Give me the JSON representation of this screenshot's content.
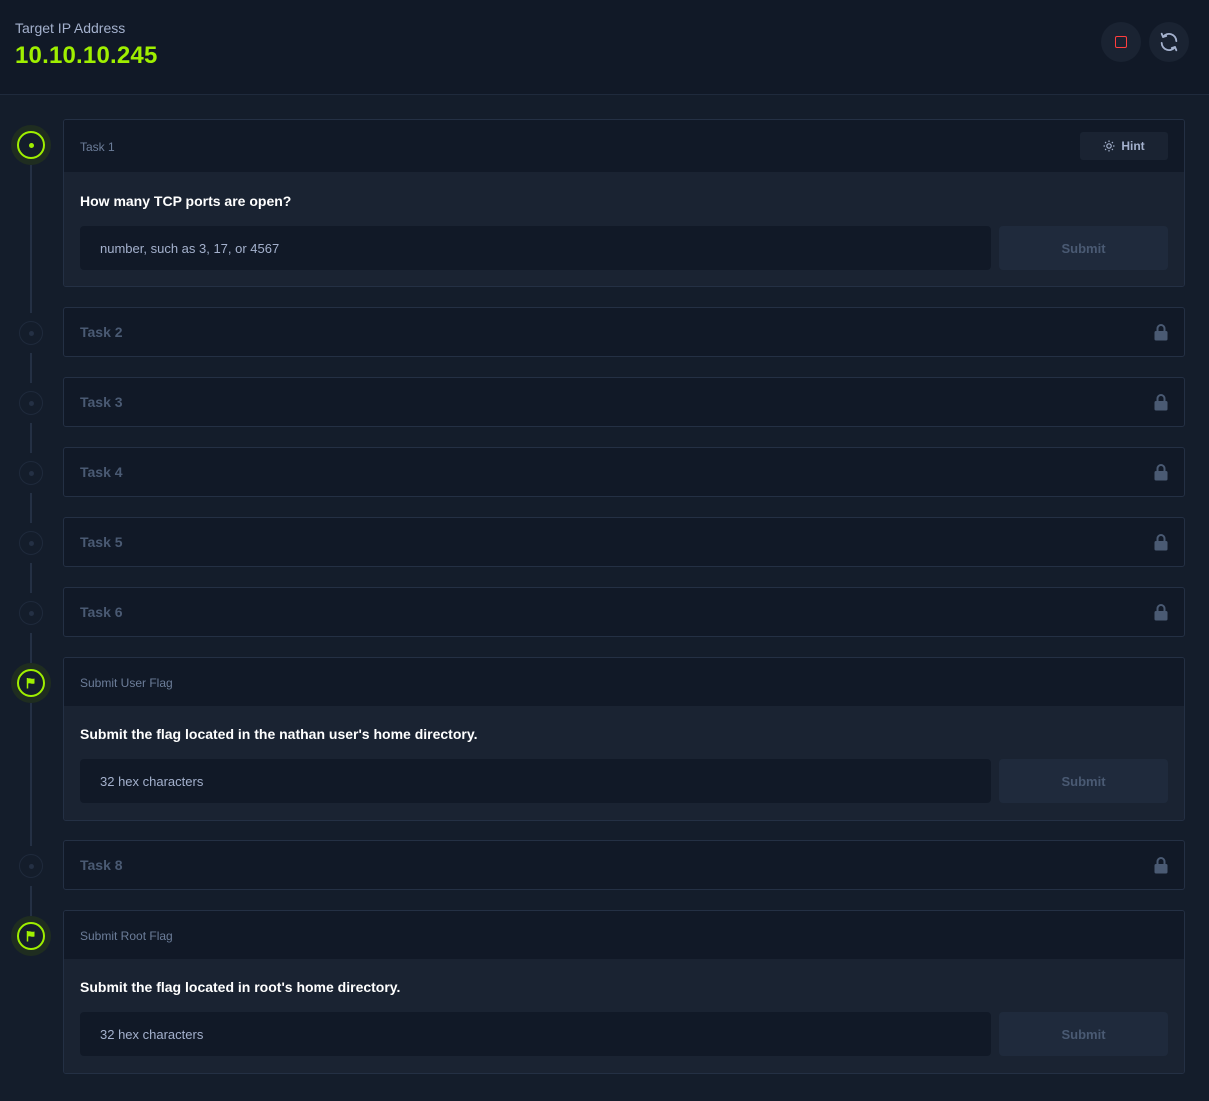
{
  "header": {
    "ip_label": "Target IP Address",
    "ip_value": "10.10.10.245",
    "stop_icon": "stop-square-icon",
    "reset_icon": "refresh-icon"
  },
  "colors": {
    "accent": "#9fef00",
    "stop": "#ff3e3e",
    "background": "#141d2b",
    "panel": "#111927",
    "body": "#1a2332"
  },
  "tasks": [
    {
      "title": "Task 1",
      "state": "active",
      "hint_label": "Hint",
      "question": "How many TCP ports are open?",
      "placeholder": "number, such as 3, 17, or 4567",
      "submit_label": "Submit"
    },
    {
      "title": "Task 2",
      "state": "locked"
    },
    {
      "title": "Task 3",
      "state": "locked"
    },
    {
      "title": "Task 4",
      "state": "locked"
    },
    {
      "title": "Task 5",
      "state": "locked"
    },
    {
      "title": "Task 6",
      "state": "locked"
    },
    {
      "title": "Submit User Flag",
      "state": "flag",
      "question": "Submit the flag located in the nathan user's home directory.",
      "placeholder": "32 hex characters",
      "submit_label": "Submit"
    },
    {
      "title": "Task 8",
      "state": "locked"
    },
    {
      "title": "Submit Root Flag",
      "state": "flag",
      "question": "Submit the flag located in root's home directory.",
      "placeholder": "32 hex characters",
      "submit_label": "Submit"
    }
  ]
}
